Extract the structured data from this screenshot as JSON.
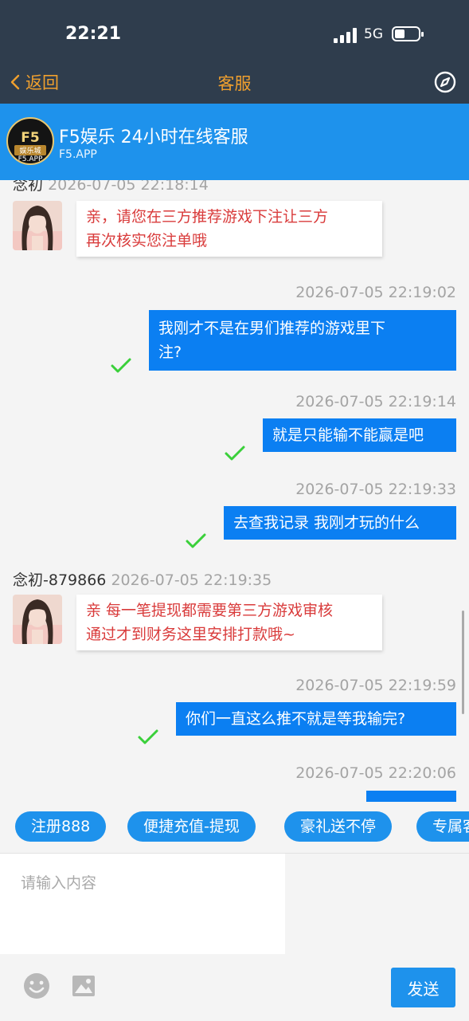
{
  "status": {
    "time": "22:21",
    "network": "5G"
  },
  "nav": {
    "back_label": "返回",
    "title": "客服"
  },
  "header": {
    "logo": {
      "top": "F5",
      "middle": "娱乐城",
      "bottom": "F5.APP"
    },
    "title": "F5娱乐 24小时在线客服",
    "subtitle": "F5.APP"
  },
  "messages": [
    {
      "type": "sender",
      "name": "念初",
      "time": "2026-07-05 22:18:14"
    },
    {
      "type": "in",
      "lines": [
        "亲，请您在三方推荐游戏下注让三方",
        "再次核实您注单哦"
      ]
    },
    {
      "type": "out",
      "time": "2026-07-05 22:19:02",
      "lines": [
        "我刚才不是在男们推荐的游戏里下",
        "注?"
      ]
    },
    {
      "type": "out",
      "time": "2026-07-05 22:19:14",
      "lines": [
        "就是只能输不能赢是吧"
      ]
    },
    {
      "type": "out",
      "time": "2026-07-05 22:19:33",
      "lines": [
        "去查我记录 我刚才玩的什么"
      ]
    },
    {
      "type": "sender",
      "name": "念初-879866",
      "time": "2026-07-05 22:19:35"
    },
    {
      "type": "in",
      "lines": [
        "亲 每一笔提现都需要第三方游戏审核",
        "通过才到财务这里安排打款哦~"
      ]
    },
    {
      "type": "out",
      "time": "2026-07-05 22:19:59",
      "lines": [
        "你们一直这么推不就是等我输完?"
      ]
    },
    {
      "type": "out",
      "time": "2026-07-05 22:20:06",
      "lines": [
        ""
      ]
    }
  ],
  "quick_replies": [
    "注册888",
    "便捷充值-提现",
    "豪礼送不停",
    "专属客服"
  ],
  "input": {
    "placeholder": "请输入内容",
    "value": ""
  },
  "send_label": "发送",
  "colors": {
    "header_blue": "#1e92ec",
    "out_bubble": "#0b7ff2",
    "in_text": "#d93b3b",
    "check": "#3ad03a",
    "nav_accent": "#f0a02e",
    "dark_bar": "#2f3d4d"
  }
}
